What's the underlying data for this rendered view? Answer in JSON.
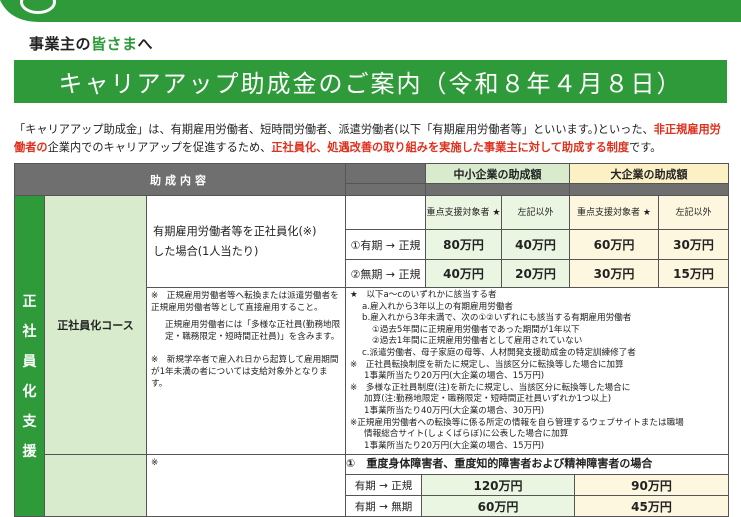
{
  "colors": {
    "brand_green": "#2f9a3a",
    "light_green": "#d8eccd",
    "light_yellow": "#fbf1c4",
    "accent_red": "#e0301e",
    "header_grey": "#6f6f6f"
  },
  "audience": {
    "prefix": "事業主の",
    "highlight": "皆さま",
    "suffix": "へ"
  },
  "title": "キャリアアップ助成金のご案内（令和８年４月８日）",
  "intro": {
    "p1": "「キャリアアップ助成金」は、有期雇用労働者、短時間労働者、派遣労働者(以下「有期雇用労働者等」といいます。)といった、",
    "p1_red": "非正規雇用労働者の",
    "p2": "企業内でのキャリアアップを促進するため、",
    "p2_red": "正社員化、処遇改善の取り組みを実施した事業主に対して助成する制度",
    "p3": "です。"
  },
  "table": {
    "header_content": "助成内容",
    "header_sme": "中小企業の助成額",
    "header_large": "大企業の助成額",
    "sub_priority": "重点支援対象者 ★",
    "sub_other": "左記以外",
    "side_label": [
      "正",
      "社",
      "員",
      "化",
      "支",
      "援"
    ],
    "course_name": "正社員化コース",
    "desc_line1": "有期雇用労働者等を正社員化(※)",
    "desc_line2": "した場合(1人当たり)",
    "rows": [
      {
        "label": "①有期 → 正規",
        "v1": "80万円",
        "v2": "40万円",
        "v3": "60万円",
        "v4": "30万円"
      },
      {
        "label": "②無期 → 正規",
        "v1": "40万円",
        "v2": "20万円",
        "v3": "30万円",
        "v4": "15万円"
      }
    ],
    "left_notes": [
      "※　正規雇用労働者等へ転換または派遣労働者を正規雇用労働者等として直接雇用すること。",
      "正規雇用労働者には「多様な正社員(勤務地限定・職務限定・短時間正社員)」を含みます。",
      "※　新規学卒者で雇入れ日から起算して雇用期間が1年未満の者については支給対象外となります。"
    ],
    "right_notes": [
      "★　以下a～cのいずれかに該当する者",
      "a.雇入れから3年以上の有期雇用労働者",
      "b.雇入れから3年未満で、次の①②いずれにも該当する有期雇用労働者",
      "①過去5年間に正規雇用労働者であった期間が1年以下",
      "②過去1年間に正規雇用労働者として雇用されていない",
      "c.派遣労働者、母子家庭の母等、人材開発支援助成金の特定訓練修了者",
      "※　正社員転換制度を新たに規定し、当該区分に転換等した場合に加算",
      "1事業所当たり20万円(大企業の場合、15万円)",
      "※　多様な正社員制度(注)を新たに規定し、当該区分に転換等した場合に",
      "加算(注:勤務地限定・職務限定・短時間正社員いずれか1つ以上)",
      "1事業所当たり40万円(大企業の場合、30万円)",
      "※正規雇用労働者への転換等に係る所定の情報を自ら管理するウェブサイトまたは職場",
      "情報総合サイト(しょくばらぼ)に公表した場合に加算",
      "1事業所当たり20万円(大企業の場合、15万円)"
    ],
    "section2_title": "①　重度身体障害者、重度知的障害者および精神障害者の場合",
    "section2_rows": [
      {
        "label": "有期 → 正規",
        "sme": "120万円",
        "large": "90万円"
      },
      {
        "label": "有期 → 無期",
        "sme": "60万円",
        "large": "45万円"
      }
    ]
  }
}
